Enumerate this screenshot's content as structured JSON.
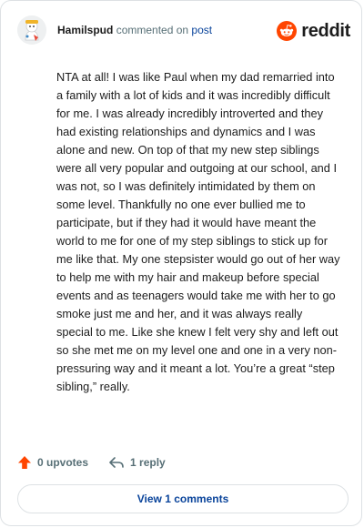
{
  "comment": {
    "username": "Hamilspud",
    "action_text": "commented on",
    "post_link": "post",
    "brand": "reddit",
    "body": "NTA at all! I was like Paul when my dad remarried into a family with a lot of kids and it was incredibly difficult for me. I was already incredibly introverted and they had existing relationships and dynamics and I was alone and new. On top of that my new step siblings were all very popular and outgoing at our school, and I was not, so I was definitely intimidated by them on some level. Thankfully no one ever bullied me to participate, but if they had it would have meant the world to me for one of my step siblings to stick up for me like that. My one stepsister would go out of her way to help me with my hair and makeup before special events and as teenagers would take me with her to go smoke just me and her, and it was always really special to me. Like she knew I felt very shy and left out so she met me on my level one and one in a very non-pressuring way and it meant a lot. You’re a great “step sibling,” really."
  },
  "actions": {
    "upvotes_label": "0 upvotes",
    "reply_label": "1 reply",
    "upvote_icon": "upvote-arrow-icon",
    "reply_icon": "reply-arrow-icon"
  },
  "footer": {
    "view_comments_label": "View 1 comments"
  },
  "colors": {
    "brand_orange": "#ff4500",
    "link_blue": "#0a449b",
    "muted": "#576f76"
  }
}
